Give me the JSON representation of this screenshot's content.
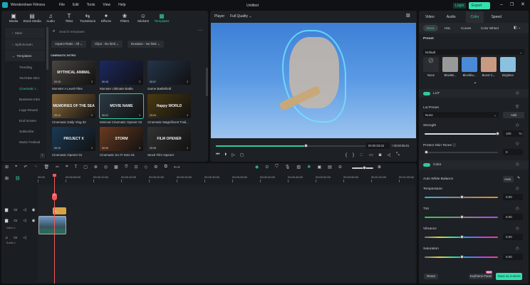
{
  "app": {
    "name": "Wondershare Filmora",
    "project_title": "Untitled",
    "menu": [
      "File",
      "Edit",
      "Tools",
      "View",
      "Help"
    ],
    "login": "Login",
    "export": "Export"
  },
  "toolbar": [
    {
      "icon": "media-icon",
      "label": "Media"
    },
    {
      "icon": "stock-media-icon",
      "label": "Stock Media"
    },
    {
      "icon": "audio-icon",
      "label": "Audio"
    },
    {
      "icon": "titles-icon",
      "label": "Titles"
    },
    {
      "icon": "transitions-icon",
      "label": "Transitions"
    },
    {
      "icon": "effects-icon",
      "label": "Effects"
    },
    {
      "icon": "filters-icon",
      "label": "Filters"
    },
    {
      "icon": "stickers-icon",
      "label": "Stickers"
    },
    {
      "icon": "templates-icon",
      "label": "Templates"
    }
  ],
  "sidebar": {
    "items": [
      "Mine",
      "Split Screen",
      "Templates"
    ],
    "sub": [
      "Trending",
      "YouTube Intro",
      "Cinematic I...",
      "Business Intro",
      "Logo Reveal",
      "End Screen",
      "Subscribe",
      "Music Festival"
    ],
    "active": "Cinematic I..."
  },
  "search": {
    "placeholder": "Search templates"
  },
  "filters": [
    "Aspect Ratio : All",
    "Clips : No limit",
    "Duration : No limit"
  ],
  "section": "CINEMATIC INTRO",
  "templates": [
    {
      "title": "Monster A Level Files",
      "dur": "00:15",
      "text": "MYTHICAL ANIMAL",
      "bg": "#4a4540"
    },
    {
      "title": "Monster Ultimate Battle",
      "dur": "00:15",
      "text": "",
      "bg": "#1c2860"
    },
    {
      "title": "Game Battlefield",
      "dur": "00:07",
      "text": "",
      "bg": "#23344a"
    },
    {
      "title": "Cinematic Daily Vlog 02",
      "dur": "00:14",
      "text": "MEMORIES OF THE SEA",
      "bg": "#8a6a3a"
    },
    {
      "title": "Minimal Cinematic Opener 02",
      "dur": "00:21",
      "text": "MOVIE NAME",
      "bg": "#2c3a44"
    },
    {
      "title": "Cinematic Magnificent Trail...",
      "dur": "00:04",
      "text": "Happy WORLD",
      "bg": "#4a3a10"
    },
    {
      "title": "Cinematic Opener 01",
      "dur": "00:19",
      "text": "PROJECT X",
      "bg": "#1a3a55"
    },
    {
      "title": "Cinematic Sci Fi Intro 01",
      "dur": "00:09",
      "text": "STORM",
      "bg": "#6a3a20"
    },
    {
      "title": "Stock Film Opener",
      "dur": "00:05",
      "text": "FILM OPENER",
      "bg": "#333"
    }
  ],
  "player": {
    "label": "Player",
    "quality": "Full Quality",
    "current": "00:00:03:02",
    "total": "00:00:05:01",
    "progress": 0.6
  },
  "timeline": {
    "ticks": [
      "00:00",
      "00:00:05:00",
      "00:00:10:00",
      "00:00:15:00",
      "00:00:20:00",
      "00:00:25:00",
      "00:00:30:00",
      "00:00:35:00",
      "00:00:40:00",
      "00:00:45:00",
      "00:00:50:00",
      "00:00:55:00",
      "00:01:00:00",
      "00:01:05:00"
    ],
    "tracks": [
      "Video 1",
      "Audio 1"
    ],
    "clip_label": "R..."
  },
  "right": {
    "tabs": [
      "Video",
      "Audio",
      "Color",
      "Speed"
    ],
    "active_tab": "Color",
    "subtabs": [
      "Basic",
      "HSL",
      "Curves",
      "Color Wheel"
    ],
    "preset_label": "Preset",
    "preset_value": "Default",
    "presets": [
      "None",
      "BlackB...",
      "Blockbu...",
      "Boost C...",
      "Brighten"
    ],
    "lut": "LUT",
    "lut_preset": "Lut Preset",
    "lut_value": "None",
    "add": "Add",
    "strength": "Strength",
    "strength_value": "100",
    "strength_unit": "%",
    "protect": "Protect Skin Tones",
    "protect_value": "0",
    "color": "Color",
    "awb": "Auto White Balance",
    "auto": "Auto",
    "adjust": [
      {
        "label": "Temperature",
        "value": "0.00"
      },
      {
        "label": "Tint",
        "value": "0.00"
      },
      {
        "label": "Vibrance",
        "value": "0.00"
      },
      {
        "label": "Saturation",
        "value": "0.00"
      }
    ],
    "reset": "Reset",
    "keyframe": "Keyframe Panel",
    "new_badge": "NEW",
    "save": "Save as custom"
  },
  "colors": {
    "accent": "#34c9a0",
    "playhead": "#f0595a"
  }
}
